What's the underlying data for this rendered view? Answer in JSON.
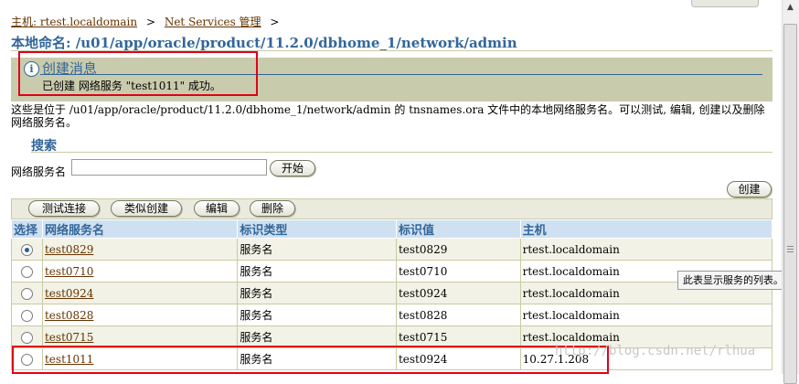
{
  "breadcrumb": {
    "host_link": "主机: rtest.localdomain",
    "net_services_link": "Net Services 管理",
    "separator": ">"
  },
  "page": {
    "title": "本地命名: /u01/app/oracle/product/11.2.0/dbhome_1/network/admin"
  },
  "confirmation": {
    "icon": "info-icon",
    "title": "创建消息",
    "message": "已创建 网络服务 \"test1011\" 成功。"
  },
  "description": "这些是位于 /u01/app/oracle/product/11.2.0/dbhome_1/network/admin 的 tnsnames.ora 文件中的本地网络服务名。可以测试, 编辑, 创建以及删除网络服务名。",
  "search": {
    "heading": "搜索",
    "label": "网络服务名",
    "value": "",
    "go_label": "开始"
  },
  "create_label": "创建",
  "toolbar": {
    "test_label": "测试连接",
    "create_like_label": "类似创建",
    "edit_label": "编辑",
    "delete_label": "删除"
  },
  "table": {
    "headers": [
      "选择",
      "网络服务名",
      "标识类型",
      "标识值",
      "主机"
    ],
    "rows": [
      {
        "selected": true,
        "name": "test0829",
        "id_type": "服务名",
        "id_value": "test0829",
        "host": "rtest.localdomain"
      },
      {
        "selected": false,
        "name": "test0710",
        "id_type": "服务名",
        "id_value": "test0710",
        "host": "rtest.localdomain"
      },
      {
        "selected": false,
        "name": "test0924",
        "id_type": "服务名",
        "id_value": "test0924",
        "host": "rtest.localdomain"
      },
      {
        "selected": false,
        "name": "test0828",
        "id_type": "服务名",
        "id_value": "test0828",
        "host": "rtest.localdomain"
      },
      {
        "selected": false,
        "name": "test0715",
        "id_type": "服务名",
        "id_value": "test0715",
        "host": "rtest.localdomain"
      },
      {
        "selected": false,
        "name": "test1011",
        "id_type": "服务名",
        "id_value": "test0924",
        "host": "10.27.1.208"
      }
    ]
  },
  "tooltip": "此表显示服务的列表。",
  "watermark": "http://blog.csdn.net/rlhua",
  "colors": {
    "title_blue": "#336699",
    "link_brown": "#663300",
    "highlight_red": "#e0001a",
    "header_bg": "#cfe0f1",
    "confirm_bg": "#c9cbad"
  }
}
